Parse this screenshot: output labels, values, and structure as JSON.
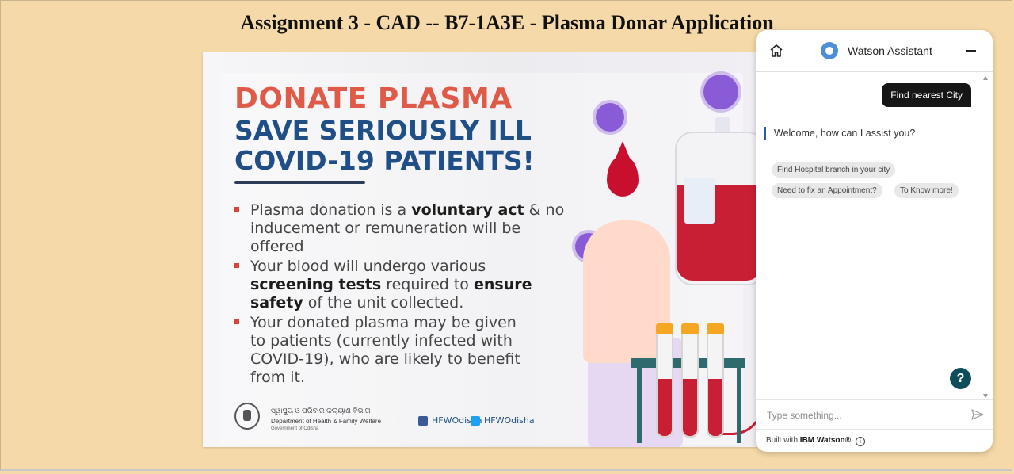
{
  "page": {
    "title": "Assignment 3 - CAD -- B7-1A3E - Plasma Donar Application"
  },
  "poster": {
    "headline_1": "DONATE PLASMA",
    "headline_2a": "SAVE SERIOUSLY ILL",
    "headline_2b": "COVID-19 PATIENTS!",
    "bullets": [
      {
        "pre": "Plasma donation is a ",
        "bold1": "voluntary act",
        "mid": " & no inducement or remuneration will be offered",
        "bold2": "",
        "post": ""
      },
      {
        "pre": "Your blood will undergo various ",
        "bold1": "screening tests",
        "mid": " required to ",
        "bold2": "ensure safety",
        "post": " of the unit collected."
      },
      {
        "pre": "Your donated plasma may be given to patients (currently infected with COVID-19), who are likely to benefit from it.",
        "bold1": "",
        "mid": "",
        "bold2": "",
        "post": ""
      }
    ],
    "org_odia": "ସ୍ୱାସ୍ଥ୍ୟ ଓ ପରିବାର କଲ୍ୟାଣ ବିଭାଗ",
    "org_name": "Department of Health & Family Welfare",
    "org_gov": "Government of Odisha",
    "facebook_handle": "HFWOdisha",
    "twitter_handle": "HFWOdisha",
    "colors": {
      "headline_red": "#e05a48",
      "headline_blue": "#1f4f86",
      "facebook": "#3b5998",
      "twitter": "#1da1f2"
    }
  },
  "watson": {
    "title": "Watson Assistant",
    "icons": {
      "home": "home-icon",
      "minimize": "minimize-icon",
      "help": "help-icon",
      "send": "send-icon",
      "info": "info-icon"
    },
    "user_message": "Find nearest City",
    "bot_message": "Welcome, how can I assist you?",
    "options": [
      "Find Hospital branch in your city",
      "Need to fix an Appointment?",
      "To Know more!"
    ],
    "input_placeholder": "Type something...",
    "footer_prefix": "Built with ",
    "footer_brand": "IBM Watson®",
    "help_label": "?",
    "info_label": "i"
  }
}
